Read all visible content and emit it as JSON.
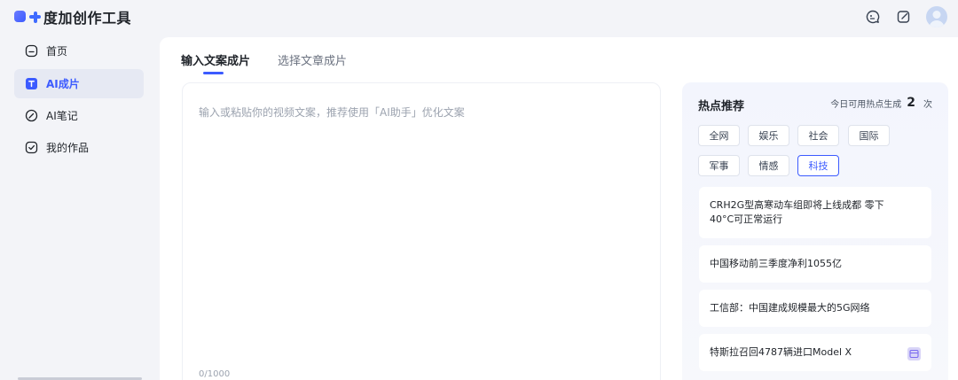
{
  "app": {
    "brand": "度加创作工具",
    "logo_icon": "brand-plus-logo",
    "accent_color": "#3c5bff"
  },
  "topbar": {
    "icons": [
      "hint-bubble-icon",
      "edit-note-icon",
      "user-avatar-icon"
    ]
  },
  "sidebar": {
    "items": [
      {
        "label": "首页",
        "icon": "home-icon",
        "active": false
      },
      {
        "label": "AI成片",
        "icon": "ai-video-icon",
        "active": true
      },
      {
        "label": "AI笔记",
        "icon": "pen-note-icon",
        "active": false
      },
      {
        "label": "我的作品",
        "icon": "my-works-icon",
        "active": false
      }
    ]
  },
  "main": {
    "tabs": [
      {
        "label": "输入文案成片",
        "active": true
      },
      {
        "label": "选择文章成片",
        "active": false
      }
    ],
    "editor": {
      "placeholder": "输入或粘贴你的视频文案，推荐使用「AI助手」优化文案",
      "counter": "0/1000"
    }
  },
  "hot": {
    "title": "热点推荐",
    "quota_label": "今日可用热点生成",
    "quota_value": "2",
    "quota_unit": "次",
    "tags": [
      {
        "label": "全网",
        "active": false
      },
      {
        "label": "娱乐",
        "active": false
      },
      {
        "label": "社会",
        "active": false
      },
      {
        "label": "国际",
        "active": false
      },
      {
        "label": "军事",
        "active": false
      },
      {
        "label": "情感",
        "active": false
      },
      {
        "label": "科技",
        "active": true
      }
    ],
    "news": [
      {
        "title": "CRH2G型高寒动车组即将上线成都 零下40°C可正常运行"
      },
      {
        "title": "中国移动前三季度净利1055亿"
      },
      {
        "title": "工信部：中国建成规模最大的5G网络"
      },
      {
        "title": "特斯拉召回4787辆进口Model X"
      }
    ]
  }
}
